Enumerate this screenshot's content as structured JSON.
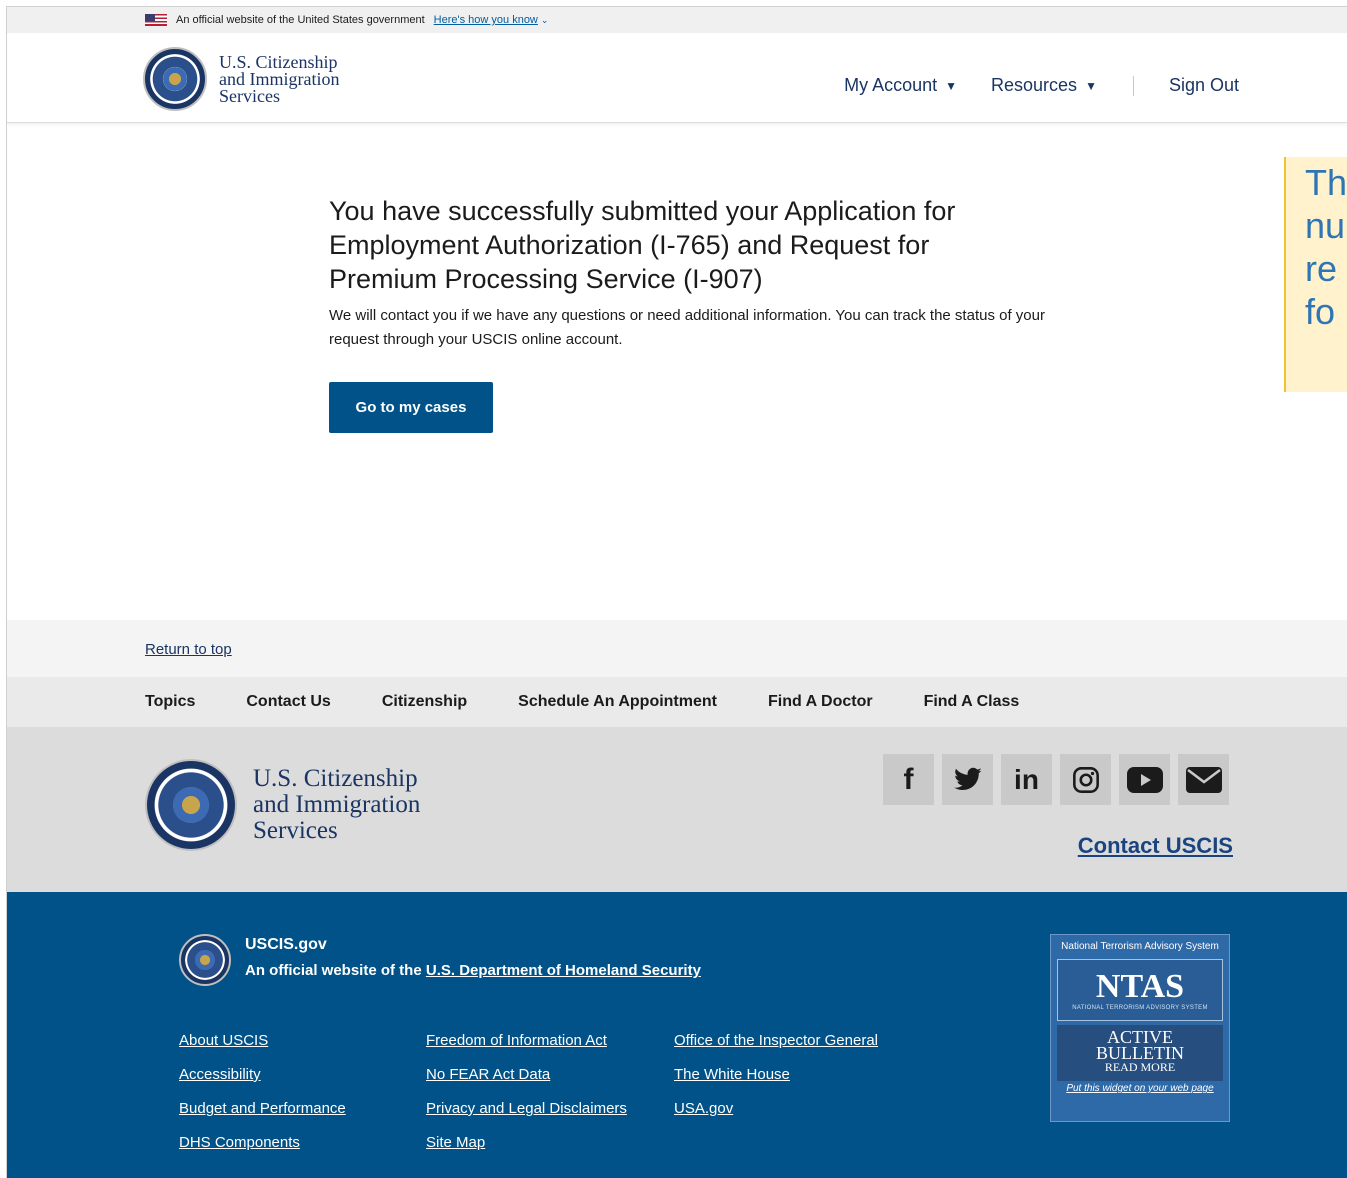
{
  "gov_banner": {
    "text": "An official website of the United States government",
    "link": "Here's how you know"
  },
  "header": {
    "logo": {
      "line1": "U.S. Citizenship",
      "line2": "and Immigration",
      "line3": "Services"
    },
    "nav": {
      "my_account": "My Account",
      "resources": "Resources",
      "sign_out": "Sign Out"
    }
  },
  "main": {
    "title": "You have successfully submitted your Application for Employment Authorization (I-765) and Request for Premium Processing Service (I-907)",
    "body": "We will contact you if we have any questions or need additional information. You can track the status of your request through your USCIS online account.",
    "button": "Go to my cases"
  },
  "callout": {
    "lines": [
      "Th",
      "nu",
      "re",
      "fo"
    ]
  },
  "footer": {
    "return_to_top": "Return to top",
    "nav": [
      "Topics",
      "Contact Us",
      "Citizenship",
      "Schedule An Appointment",
      "Find A Doctor",
      "Find A Class"
    ],
    "logo": {
      "line1": "U.S. Citizenship",
      "line2": "and Immigration",
      "line3": "Services"
    },
    "social": [
      {
        "icon": "facebook-icon",
        "glyph": "f"
      },
      {
        "icon": "twitter-icon",
        "glyph": ""
      },
      {
        "icon": "linkedin-icon",
        "glyph": "in"
      },
      {
        "icon": "instagram-icon",
        "glyph": ""
      },
      {
        "icon": "youtube-icon",
        "glyph": ""
      },
      {
        "icon": "email-icon",
        "glyph": ""
      }
    ],
    "contact": "Contact USCIS",
    "site": "USCIS.gov",
    "official_prefix": "An official website of the ",
    "official_link": "U.S. Department of Homeland Security",
    "links_col1": [
      "About USCIS",
      "Accessibility",
      "Budget and Performance",
      "DHS Components"
    ],
    "links_col2": [
      "Freedom of Information Act",
      "No FEAR Act Data",
      "Privacy and Legal Disclaimers",
      "Site Map"
    ],
    "links_col3": [
      "Office of the Inspector General",
      "The White House",
      "USA.gov"
    ],
    "ntas": {
      "top": "National Terrorism Advisory System",
      "word": "NTAS",
      "small": "NATIONAL TERRORISM ADVISORY SYSTEM",
      "active": "ACTIVE",
      "bulletin": "BULLETIN",
      "read_more": "READ MORE",
      "widget": "Put this widget on your web page"
    }
  },
  "colors": {
    "primary": "#005288",
    "footer_blue": "#005288",
    "link": "#005ea2",
    "callout_bg": "#fff2cc",
    "callout_text": "#2e75b6"
  }
}
